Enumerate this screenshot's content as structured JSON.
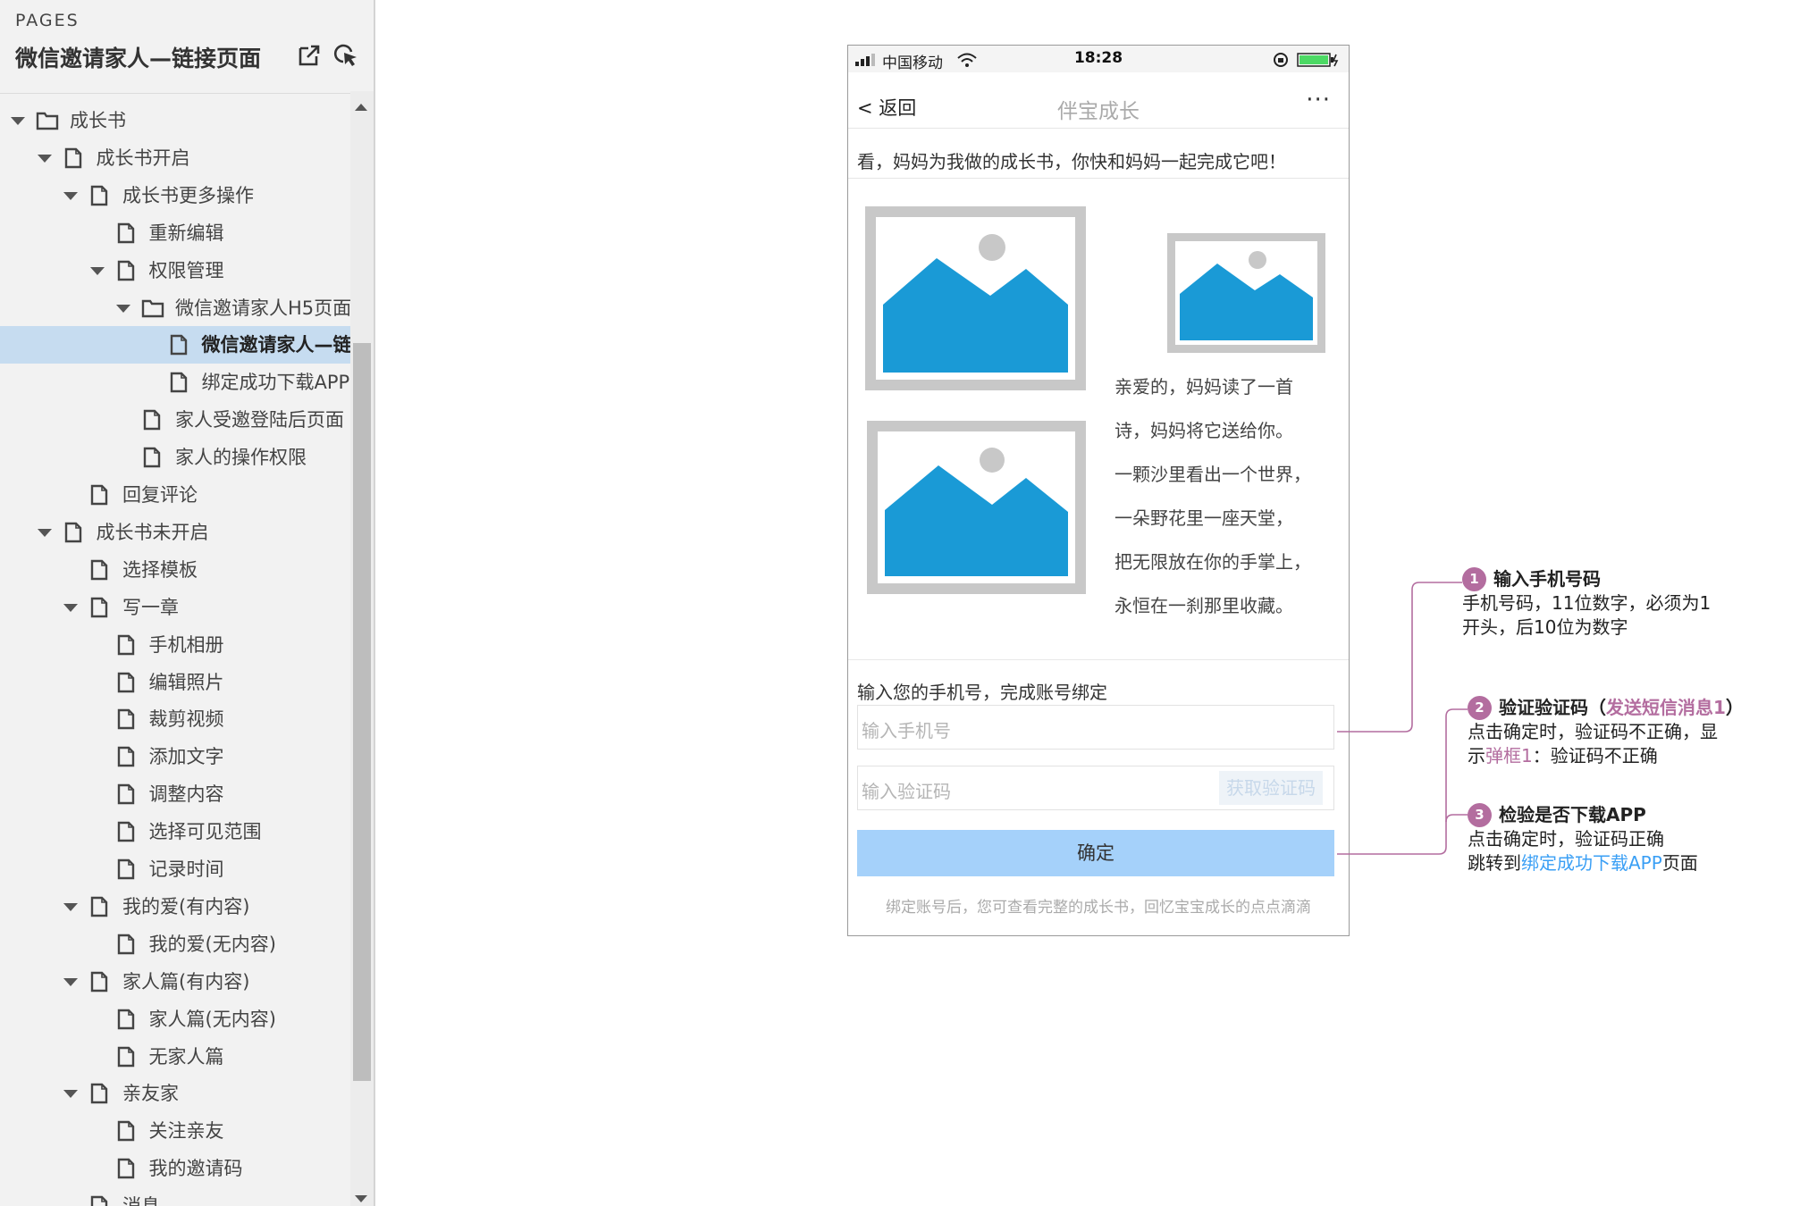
{
  "sidebar": {
    "header_label": "PAGES",
    "title": "微信邀请家人—链接页面",
    "tools": [
      "export-icon",
      "cursor-icon"
    ],
    "items": [
      {
        "label": "成长书",
        "level": 0,
        "type": "folder",
        "expanded": true
      },
      {
        "label": "成长书开启",
        "level": 1,
        "type": "page",
        "expanded": true
      },
      {
        "label": "成长书更多操作",
        "level": 2,
        "type": "page",
        "expanded": true
      },
      {
        "label": "重新编辑",
        "level": 3,
        "type": "page"
      },
      {
        "label": "权限管理",
        "level": 3,
        "type": "page",
        "expanded": true
      },
      {
        "label": "微信邀请家人H5页面",
        "level": 4,
        "type": "folder",
        "expanded": true
      },
      {
        "label": "微信邀请家人—链接页面",
        "level": 5,
        "type": "page",
        "selected": true
      },
      {
        "label": "绑定成功下载APP",
        "level": 5,
        "type": "page"
      },
      {
        "label": "家人受邀登陆后页面",
        "level": 4,
        "type": "page"
      },
      {
        "label": "家人的操作权限",
        "level": 4,
        "type": "page"
      },
      {
        "label": "回复评论",
        "level": 2,
        "type": "page"
      },
      {
        "label": "成长书未开启",
        "level": 1,
        "type": "page",
        "expanded": true
      },
      {
        "label": "选择模板",
        "level": 2,
        "type": "page"
      },
      {
        "label": "写一章",
        "level": 2,
        "type": "page",
        "expanded": true
      },
      {
        "label": "手机相册",
        "level": 3,
        "type": "page"
      },
      {
        "label": "编辑照片",
        "level": 3,
        "type": "page"
      },
      {
        "label": "裁剪视频",
        "level": 3,
        "type": "page"
      },
      {
        "label": "添加文字",
        "level": 3,
        "type": "page"
      },
      {
        "label": "调整内容",
        "level": 3,
        "type": "page"
      },
      {
        "label": "选择可见范围",
        "level": 3,
        "type": "page"
      },
      {
        "label": "记录时间",
        "level": 3,
        "type": "page"
      },
      {
        "label": "我的爱(有内容)",
        "level": 2,
        "type": "page",
        "expanded": true
      },
      {
        "label": "我的爱(无内容)",
        "level": 3,
        "type": "page"
      },
      {
        "label": "家人篇(有内容)",
        "level": 2,
        "type": "page",
        "expanded": true
      },
      {
        "label": "家人篇(无内容)",
        "level": 3,
        "type": "page"
      },
      {
        "label": "无家人篇",
        "level": 3,
        "type": "page"
      },
      {
        "label": "亲友家",
        "level": 2,
        "type": "page",
        "expanded": true
      },
      {
        "label": "关注亲友",
        "level": 3,
        "type": "page"
      },
      {
        "label": "我的邀请码",
        "level": 3,
        "type": "page"
      },
      {
        "label": "消息",
        "level": 2,
        "type": "page"
      }
    ]
  },
  "phone": {
    "status": {
      "carrier": "中国移动",
      "time": "18:28"
    },
    "nav": {
      "back": "< 返回",
      "title": "伴宝成长",
      "more": "···"
    },
    "message": "看，妈妈为我做的成长书，你快和妈妈一起完成它吧！",
    "poem": [
      "亲爱的，妈妈读了一首",
      "诗，妈妈将它送给你。",
      "一颗沙里看出一个世界，",
      "一朵野花里一座天堂，",
      "把无限放在你的手掌上，",
      "永恒在一刹那里收藏。"
    ],
    "bind_label": "输入您的手机号，完成账号绑定",
    "phone_placeholder": "输入手机号",
    "code_placeholder": "输入验证码",
    "get_code": "获取验证码",
    "confirm": "确定",
    "footnote": "绑定账号后，您可查看完整的成长书，回忆宝宝成长的点点滴滴"
  },
  "annotations": [
    {
      "num": "1",
      "title": "输入手机号码",
      "line1": "手机号码，11位数字，必须为1",
      "line2": "开头，后10位为数字"
    },
    {
      "num": "2",
      "title_a": "验证验证码（",
      "title_link": "发送短信消息1",
      "title_b": "）",
      "line1": "点击确定时，验证码不正确，显",
      "line2_a": "示",
      "line2_link": "弹框1",
      "line2_b": "：验证码不正确"
    },
    {
      "num": "3",
      "title": "检验是否下载APP",
      "line1": "点击确定时，验证码正确",
      "line2_a": "跳转到",
      "line2_link": "绑定成功下载APP",
      "line2_b": "页面"
    }
  ],
  "colors": {
    "accent": "#b36d9f",
    "link": "#3a9ff5",
    "button": "#a5d1fa",
    "image": "#1a9ad6",
    "selected": "#c6dcf0"
  }
}
